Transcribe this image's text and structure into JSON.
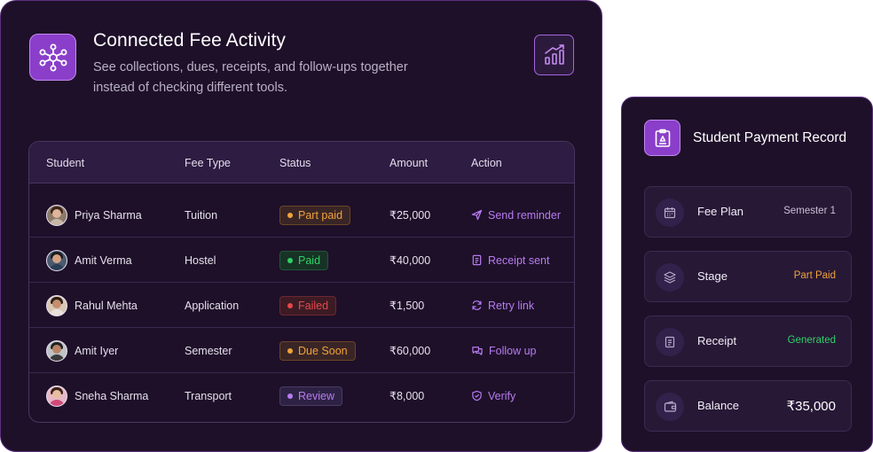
{
  "activity": {
    "title": "Connected Fee Activity",
    "subtitle": "See collections, dues, receipts, and follow-ups together instead of checking different tools."
  },
  "table": {
    "headers": [
      "Student",
      "Fee Type",
      "Status",
      "Amount",
      "Action"
    ],
    "rows": [
      {
        "student": "Priya Sharma",
        "fee_type": "Tuition",
        "status": "Part paid",
        "status_tone": "orange",
        "amount": "₹25,000",
        "action": "Send reminder",
        "action_icon": "send-icon"
      },
      {
        "student": "Amit Verma",
        "fee_type": "Hostel",
        "status": "Paid",
        "status_tone": "green",
        "amount": "₹40,000",
        "action": "Receipt sent",
        "action_icon": "receipt-icon"
      },
      {
        "student": "Rahul Mehta",
        "fee_type": "Application",
        "status": "Failed",
        "status_tone": "red",
        "amount": "₹1,500",
        "action": "Retry link",
        "action_icon": "refresh-icon"
      },
      {
        "student": "Amit Iyer",
        "fee_type": "Semester",
        "status": "Due Soon",
        "status_tone": "orange",
        "amount": "₹60,000",
        "action": "Follow up",
        "action_icon": "chat-icon"
      },
      {
        "student": "Sneha Sharma",
        "fee_type": "Transport",
        "status": "Review",
        "status_tone": "purple",
        "amount": "₹8,000",
        "action": "Verify",
        "action_icon": "shield-check-icon"
      }
    ]
  },
  "record": {
    "title": "Student Payment Record",
    "items": [
      {
        "label": "Fee Plan",
        "value": "Semester 1",
        "icon": "calendar-icon"
      },
      {
        "label": "Stage",
        "value": "Part Paid",
        "icon": "layers-icon"
      },
      {
        "label": "Receipt",
        "value": "Generated",
        "icon": "receipt-icon"
      },
      {
        "label": "Balance",
        "value": "₹35,000",
        "icon": "wallet-icon"
      }
    ]
  },
  "colors": {
    "accent": "#8a3ec9",
    "orange": "#f0a23a",
    "green": "#2fd167",
    "red": "#e5484d",
    "purple": "#b77cf0"
  }
}
